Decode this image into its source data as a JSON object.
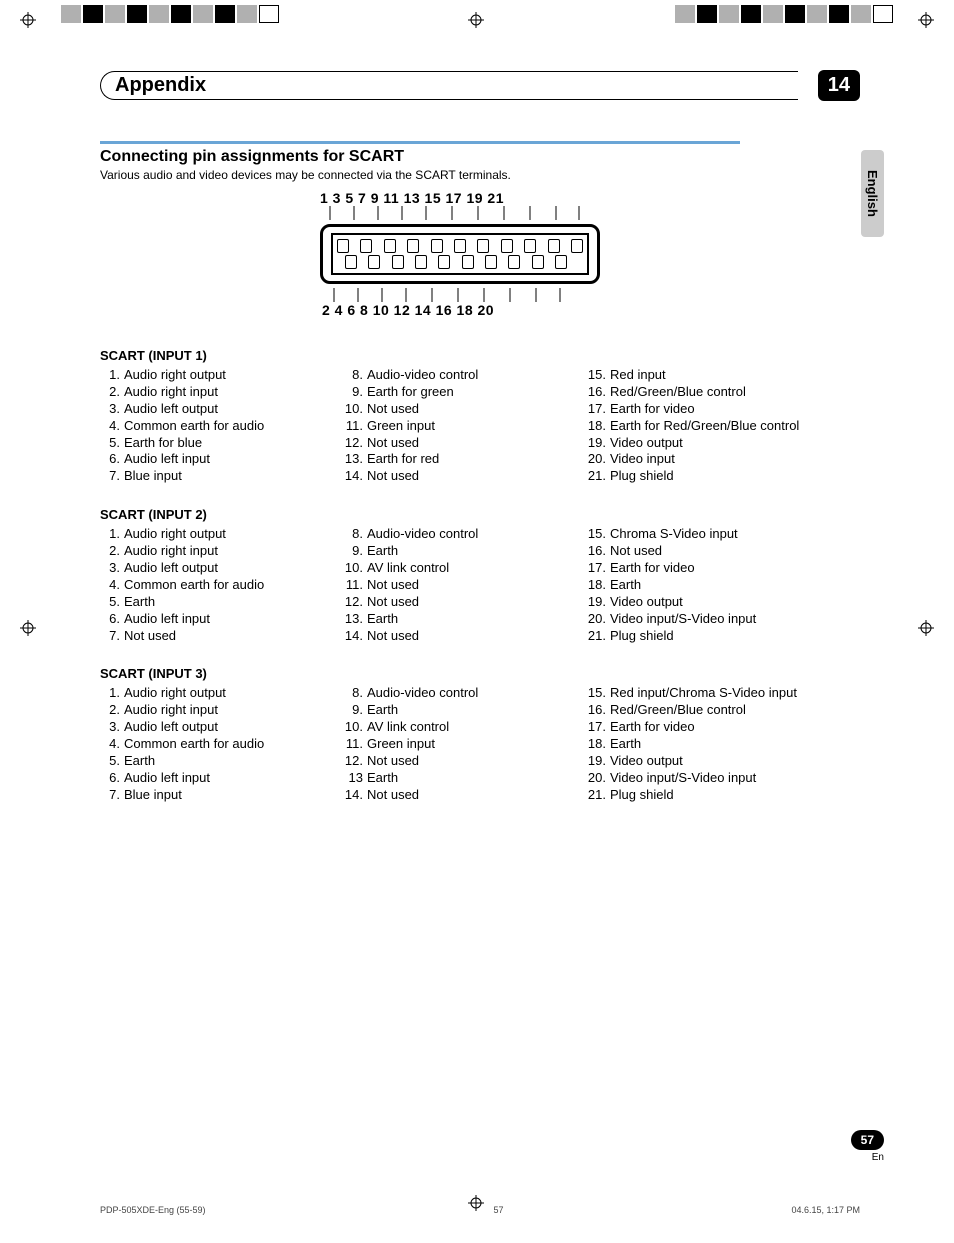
{
  "header": {
    "title": "Appendix",
    "chapter": "14"
  },
  "language_tab": "English",
  "section": {
    "heading": "Connecting pin assignments for SCART",
    "subtitle": "Various audio and video devices may be connected via the SCART terminals."
  },
  "diagram": {
    "top_numbers": "1 3 5 7 9 11 13 15 17 19 21",
    "bottom_numbers": "2 4 6 8 10 12 14 16 18 20"
  },
  "scart1": {
    "title": "SCART (INPUT 1)",
    "c1": [
      {
        "n": "1.",
        "t": "Audio right output"
      },
      {
        "n": "2.",
        "t": "Audio right input"
      },
      {
        "n": "3.",
        "t": "Audio left output"
      },
      {
        "n": "4.",
        "t": "Common earth for audio"
      },
      {
        "n": "5.",
        "t": "Earth for blue"
      },
      {
        "n": "6.",
        "t": "Audio left input"
      },
      {
        "n": "7.",
        "t": "Blue input"
      }
    ],
    "c2": [
      {
        "n": "8.",
        "t": "Audio-video control"
      },
      {
        "n": "9.",
        "t": "Earth for green"
      },
      {
        "n": "10.",
        "t": "Not used"
      },
      {
        "n": "11.",
        "t": "Green input"
      },
      {
        "n": "12.",
        "t": "Not used"
      },
      {
        "n": "13.",
        "t": "Earth for red"
      },
      {
        "n": "14.",
        "t": "Not used"
      }
    ],
    "c3": [
      {
        "n": "15.",
        "t": "Red input"
      },
      {
        "n": "16.",
        "t": "Red/Green/Blue control"
      },
      {
        "n": "17.",
        "t": "Earth for video"
      },
      {
        "n": "18.",
        "t": "Earth for Red/Green/Blue control"
      },
      {
        "n": "19.",
        "t": "Video output"
      },
      {
        "n": "20.",
        "t": "Video input"
      },
      {
        "n": "21.",
        "t": "Plug shield"
      }
    ]
  },
  "scart2": {
    "title": "SCART (INPUT 2)",
    "c1": [
      {
        "n": "1.",
        "t": "Audio right output"
      },
      {
        "n": "2.",
        "t": "Audio right input"
      },
      {
        "n": "3.",
        "t": "Audio left output"
      },
      {
        "n": "4.",
        "t": "Common earth for audio"
      },
      {
        "n": "5.",
        "t": "Earth"
      },
      {
        "n": "6.",
        "t": "Audio left input"
      },
      {
        "n": "7.",
        "t": "Not used"
      }
    ],
    "c2": [
      {
        "n": "8.",
        "t": "Audio-video control"
      },
      {
        "n": "9.",
        "t": "Earth"
      },
      {
        "n": "10.",
        "t": "AV link control"
      },
      {
        "n": "11.",
        "t": "Not used"
      },
      {
        "n": "12.",
        "t": "Not used"
      },
      {
        "n": "13.",
        "t": "Earth"
      },
      {
        "n": "14.",
        "t": "Not used"
      }
    ],
    "c3": [
      {
        "n": "15.",
        "t": "Chroma S-Video input"
      },
      {
        "n": "16.",
        "t": "Not used"
      },
      {
        "n": "17.",
        "t": "Earth for video"
      },
      {
        "n": "18.",
        "t": "Earth"
      },
      {
        "n": "19.",
        "t": "Video output"
      },
      {
        "n": "20.",
        "t": "Video input/S-Video input"
      },
      {
        "n": "21.",
        "t": "Plug shield"
      }
    ]
  },
  "scart3": {
    "title": "SCART (INPUT 3)",
    "c1": [
      {
        "n": "1.",
        "t": "Audio right output"
      },
      {
        "n": "2.",
        "t": "Audio right input"
      },
      {
        "n": "3.",
        "t": "Audio left output"
      },
      {
        "n": "4.",
        "t": "Common earth for audio"
      },
      {
        "n": "5.",
        "t": "Earth"
      },
      {
        "n": "6.",
        "t": "Audio left input"
      },
      {
        "n": "7.",
        "t": "Blue input"
      }
    ],
    "c2": [
      {
        "n": "8.",
        "t": "Audio-video control"
      },
      {
        "n": "9.",
        "t": "Earth"
      },
      {
        "n": "10.",
        "t": "AV link control"
      },
      {
        "n": "11.",
        "t": "Green input"
      },
      {
        "n": "12.",
        "t": "Not used"
      },
      {
        "n": "13",
        "t": "Earth"
      },
      {
        "n": "14.",
        "t": "Not used"
      }
    ],
    "c3": [
      {
        "n": "15.",
        "t": "Red input/Chroma S-Video input"
      },
      {
        "n": "16.",
        "t": "Red/Green/Blue control"
      },
      {
        "n": "17.",
        "t": "Earth for video"
      },
      {
        "n": "18.",
        "t": "Earth"
      },
      {
        "n": "19.",
        "t": "Video output"
      },
      {
        "n": "20.",
        "t": "Video input/S-Video input"
      },
      {
        "n": "21.",
        "t": "Plug shield"
      }
    ]
  },
  "page_number": "57",
  "page_lang": "En",
  "footer": {
    "left": "PDP-505XDE-Eng (55-59)",
    "center": "57",
    "right": "04.6.15, 1:17 PM"
  }
}
